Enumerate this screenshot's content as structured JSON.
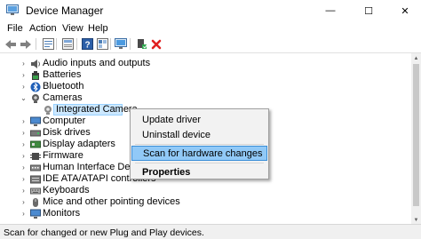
{
  "window": {
    "title": "Device Manager",
    "minimize_glyph": "—",
    "maximize_glyph": "☐",
    "close_glyph": "✕"
  },
  "menu": [
    "File",
    "Action",
    "View",
    "Help"
  ],
  "toolbar": {
    "buttons": [
      "back-icon",
      "forward-icon",
      "properties-icon",
      "update-icon",
      "help-icon",
      "show-hidden-icon",
      "scan-monitor-icon",
      "enable-device-icon",
      "uninstall-icon"
    ]
  },
  "tree": {
    "items": [
      {
        "label": "Audio inputs and outputs",
        "expander": "›",
        "icon": "speaker-icon"
      },
      {
        "label": "Batteries",
        "expander": "›",
        "icon": "battery-icon"
      },
      {
        "label": "Bluetooth",
        "expander": "›",
        "icon": "bluetooth-icon"
      },
      {
        "label": "Cameras",
        "expander": "⌄",
        "icon": "camera-icon"
      },
      {
        "label": "Integrated Camera",
        "expander": "",
        "icon": "camera-icon"
      },
      {
        "label": "Computer",
        "expander": "›",
        "icon": "computer-icon"
      },
      {
        "label": "Disk drives",
        "expander": "›",
        "icon": "disk-icon"
      },
      {
        "label": "Display adapters",
        "expander": "›",
        "icon": "display-icon"
      },
      {
        "label": "Firmware",
        "expander": "›",
        "icon": "firmware-icon"
      },
      {
        "label": "Human Interface Devic",
        "expander": "›",
        "icon": "hid-icon"
      },
      {
        "label": "IDE ATA/ATAPI controllers",
        "expander": "›",
        "icon": "ide-icon"
      },
      {
        "label": "Keyboards",
        "expander": "›",
        "icon": "keyboard-icon"
      },
      {
        "label": "Mice and other pointing devices",
        "expander": "›",
        "icon": "mouse-icon"
      },
      {
        "label": "Monitors",
        "expander": "›",
        "icon": "monitor-icon"
      }
    ]
  },
  "context_menu": {
    "items": [
      {
        "label": "Update driver"
      },
      {
        "label": "Uninstall device"
      },
      {
        "label": "Scan for hardware changes"
      },
      {
        "label": "Properties"
      }
    ]
  },
  "status": {
    "text": "Scan for changed or new Plug and Play devices."
  },
  "colors": {
    "selection": "#cce8ff",
    "menu_highlight": "#91c9f7",
    "delete_red": "#e02020",
    "status_bg": "#f0f0f0"
  }
}
